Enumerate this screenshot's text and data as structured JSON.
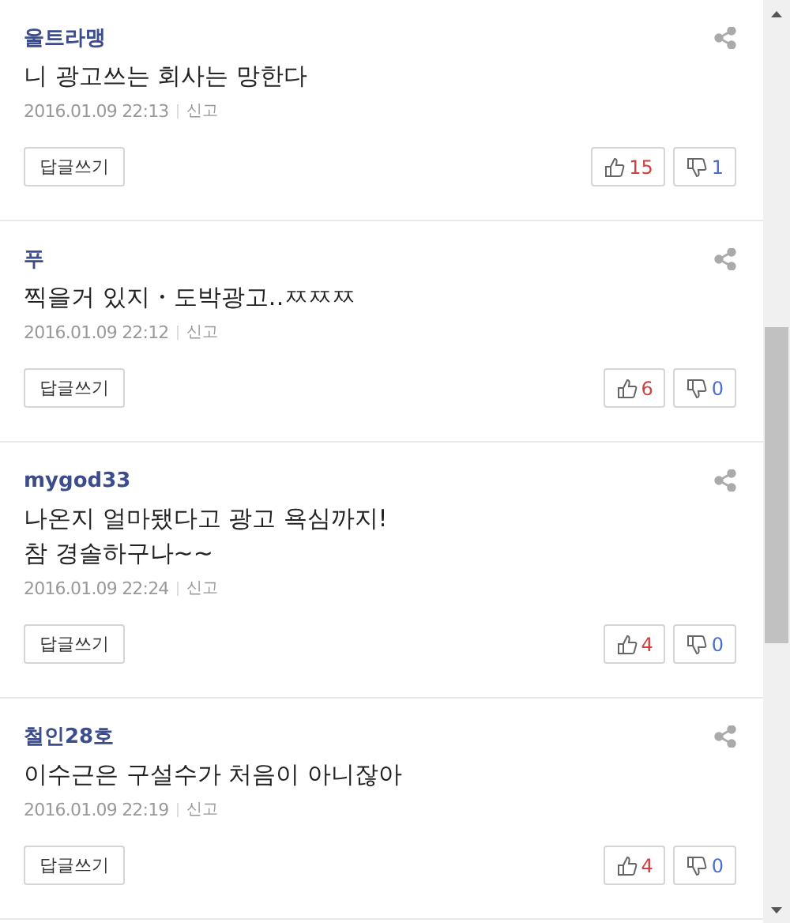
{
  "comments": [
    {
      "author": "울트라맹",
      "lines": [
        "니 광고쓰는 회사는 망한다"
      ],
      "date": "2016.01.09 22:13",
      "report": "신고",
      "reply": "답글쓰기",
      "likes": "15",
      "dislikes": "1"
    },
    {
      "author": "푸",
      "lines": [
        "찍을거 있지・도박광고‥ㅉㅉㅉ"
      ],
      "date": "2016.01.09 22:12",
      "report": "신고",
      "reply": "답글쓰기",
      "likes": "6",
      "dislikes": "0"
    },
    {
      "author": "mygod33",
      "lines": [
        "나온지 얼마됐다고 광고 욕심까지!",
        "참 경솔하구나~~"
      ],
      "date": "2016.01.09 22:24",
      "report": "신고",
      "reply": "답글쓰기",
      "likes": "4",
      "dislikes": "0"
    },
    {
      "author": "철인28호",
      "lines": [
        "이수근은 구설수가 처음이 아니잖아"
      ],
      "date": "2016.01.09 22:19",
      "report": "신고",
      "reply": "답글쓰기",
      "likes": "4",
      "dislikes": "0"
    }
  ]
}
